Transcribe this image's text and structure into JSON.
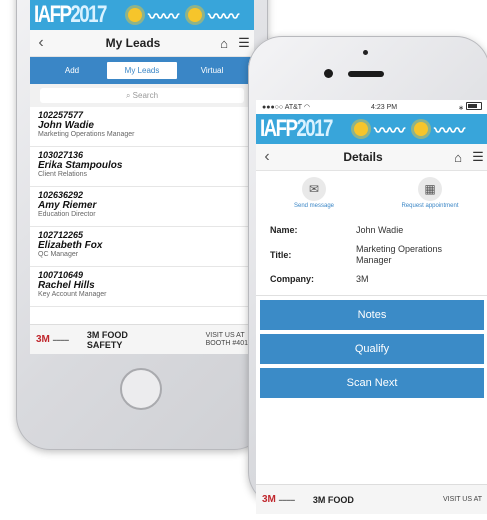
{
  "brand": {
    "logo_text": "IAFP",
    "logo_year": "2017",
    "accent": "#38a5da",
    "button_blue": "#3b8bc7"
  },
  "leads_screen": {
    "title": "My Leads",
    "tabs": [
      {
        "label": "Add",
        "active": false
      },
      {
        "label": "My Leads",
        "active": true
      },
      {
        "label": "Virtual",
        "active": false
      }
    ],
    "search_placeholder": "Search",
    "leads": [
      {
        "id": "102257577",
        "name": "John Wadie",
        "role": "Marketing Operations Manager"
      },
      {
        "id": "103027136",
        "name": "Erika Stampoulos",
        "role": "Client Relations"
      },
      {
        "id": "102636292",
        "name": "Amy Riemer",
        "role": "Education Director"
      },
      {
        "id": "102712265",
        "name": "Elizabeth Fox",
        "role": "QC Manager"
      },
      {
        "id": "100710649",
        "name": "Rachel Hills",
        "role": "Key Account Manager"
      }
    ],
    "ad": {
      "logo": "3M",
      "main_line1": "3M FOOD",
      "main_line2": "SAFETY",
      "visit_line1": "VISIT US AT",
      "visit_line2": "BOOTH #401"
    }
  },
  "details_screen": {
    "status": {
      "carrier": "AT&T",
      "time": "4:23 PM"
    },
    "title": "Details",
    "actions": [
      {
        "label": "Send message",
        "icon": "envelope-icon"
      },
      {
        "label": "Request appointment",
        "icon": "calendar-icon"
      }
    ],
    "fields": [
      {
        "key": "Name:",
        "value": "John Wadie"
      },
      {
        "key": "Title:",
        "value": "Marketing Operations Manager"
      },
      {
        "key": "Company:",
        "value": "3M"
      }
    ],
    "buttons": [
      "Notes",
      "Qualify",
      "Scan Next"
    ],
    "ad": {
      "logo": "3M",
      "main_line1": "3M FOOD",
      "visit_line1": "VISIT US AT"
    }
  }
}
